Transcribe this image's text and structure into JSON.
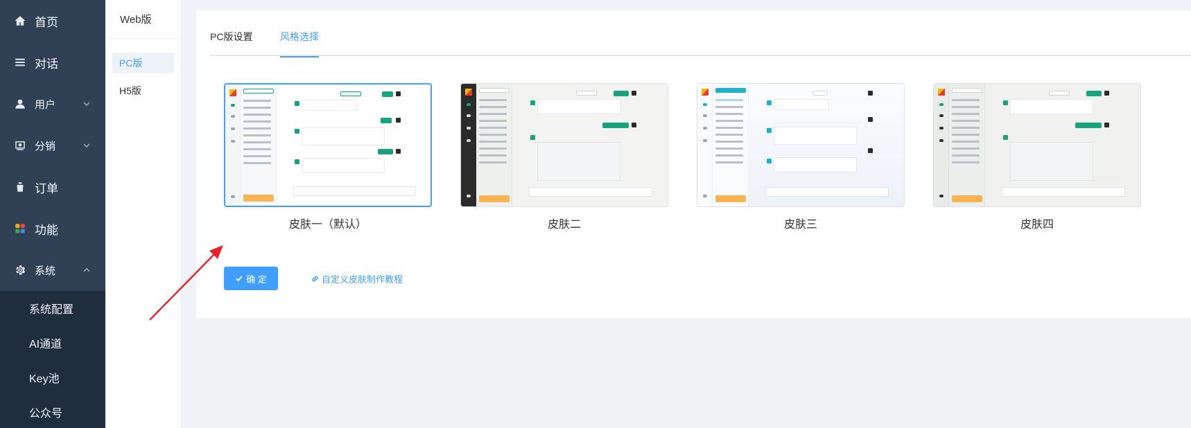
{
  "sidebar": {
    "items": [
      {
        "label": "首页",
        "icon": "home-icon"
      },
      {
        "label": "对话",
        "icon": "menu-icon"
      },
      {
        "label": "用户",
        "icon": "user-icon"
      },
      {
        "label": "分销",
        "icon": "distribution-icon"
      },
      {
        "label": "订单",
        "icon": "order-icon"
      },
      {
        "label": "功能",
        "icon": "grid-icon"
      },
      {
        "label": "系统",
        "icon": "gear-icon"
      }
    ],
    "system_children": [
      "系统配置",
      "AI通道",
      "Key池",
      "公众号"
    ]
  },
  "sidebar2": {
    "header": "Web版",
    "items": [
      {
        "label": "PC版",
        "active": true
      },
      {
        "label": "H5版",
        "active": false
      }
    ]
  },
  "tabs": [
    {
      "label": "PC版设置",
      "active": false
    },
    {
      "label": "风格选择",
      "active": true
    }
  ],
  "skins": [
    {
      "name": "皮肤一（默认）",
      "selected": true
    },
    {
      "name": "皮肤二",
      "selected": false
    },
    {
      "name": "皮肤三",
      "selected": false
    },
    {
      "name": "皮肤四",
      "selected": false
    }
  ],
  "actions": {
    "confirm_label": "确 定",
    "tutorial_link": "自定义皮肤制作教程"
  },
  "colors": {
    "sidebar_bg": "#304156",
    "submenu_bg": "#1f2d3d",
    "accent": "#409eff",
    "annotation_arrow": "#e8202a"
  }
}
